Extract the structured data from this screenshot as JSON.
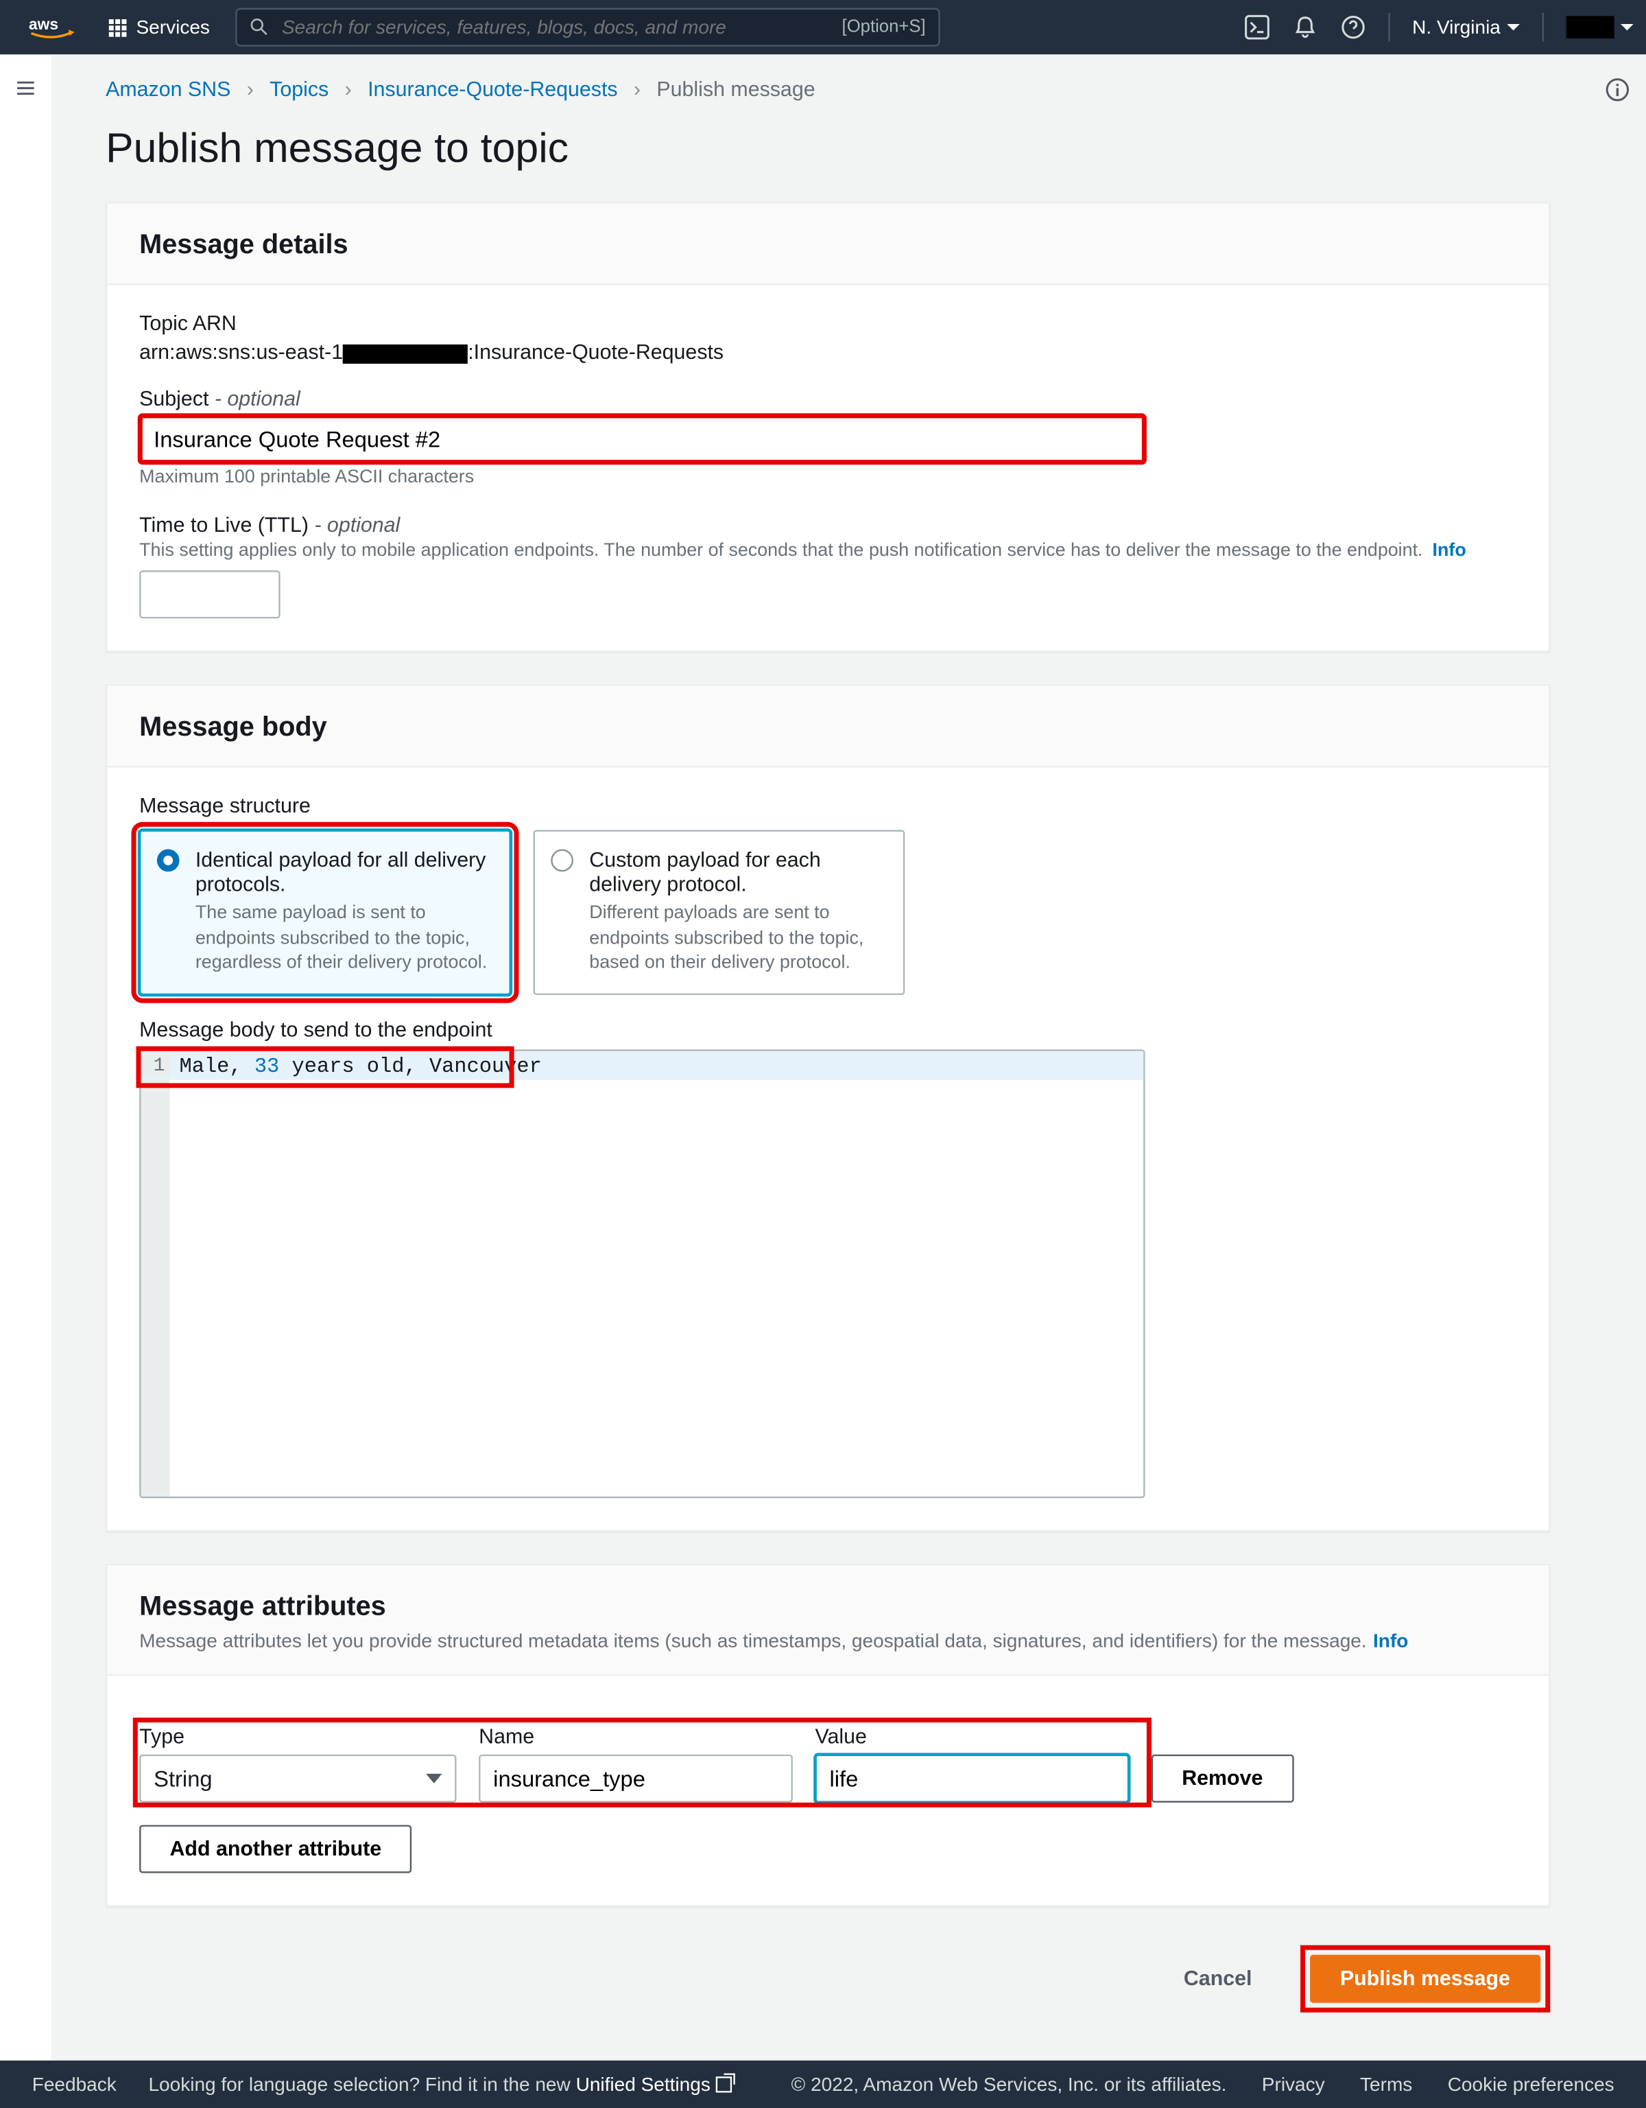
{
  "topnav": {
    "services_label": "Services",
    "search_placeholder": "Search for services, features, blogs, docs, and more",
    "search_shortcut": "[Option+S]",
    "region": "N. Virginia"
  },
  "breadcrumb": {
    "items": [
      "Amazon SNS",
      "Topics",
      "Insurance-Quote-Requests"
    ],
    "current": "Publish message"
  },
  "page_title": "Publish message to topic",
  "details": {
    "header": "Message details",
    "topic_arn_label": "Topic ARN",
    "topic_arn_prefix": "arn:aws:sns:us-east-1",
    "topic_arn_suffix": ":Insurance-Quote-Requests",
    "subject_label": "Subject",
    "subject_optional": " - optional",
    "subject_value": "Insurance Quote Request #2",
    "subject_hint": "Maximum 100 printable ASCII characters",
    "ttl_label": "Time to Live (TTL)",
    "ttl_optional": " - optional",
    "ttl_desc": "This setting applies only to mobile application endpoints. The number of seconds that the push notification service has to deliver the message to the endpoint.",
    "ttl_info": "Info"
  },
  "body": {
    "header": "Message body",
    "structure_label": "Message structure",
    "radios": [
      {
        "title": "Identical payload for all delivery protocols.",
        "desc": "The same payload is sent to endpoints subscribed to the topic, regardless of their delivery protocol.",
        "selected": true
      },
      {
        "title": "Custom payload for each delivery protocol.",
        "desc": "Different payloads are sent to endpoints subscribed to the topic, based on their delivery protocol.",
        "selected": false
      }
    ],
    "editor_label": "Message body to send to the endpoint",
    "editor_line_num": "1",
    "editor_text_pre": "Male, ",
    "editor_text_num": "33",
    "editor_text_post": " years old, Vancouver"
  },
  "attrs": {
    "header": "Message attributes",
    "desc": "Message attributes let you provide structured metadata items (such as timestamps, geospatial data, signatures, and identifiers) for the message.",
    "info": "Info",
    "type_label": "Type",
    "type_value": "String",
    "name_label": "Name",
    "name_value": "insurance_type",
    "value_label": "Value",
    "value_value": "life",
    "remove": "Remove",
    "add": "Add another attribute"
  },
  "actions": {
    "cancel": "Cancel",
    "publish": "Publish message"
  },
  "footer": {
    "feedback": "Feedback",
    "lang": "Looking for language selection? Find it in the new",
    "unified": "Unified Settings",
    "copyright": "© 2022, Amazon Web Services, Inc. or its affiliates.",
    "privacy": "Privacy",
    "terms": "Terms",
    "cookies": "Cookie preferences"
  }
}
